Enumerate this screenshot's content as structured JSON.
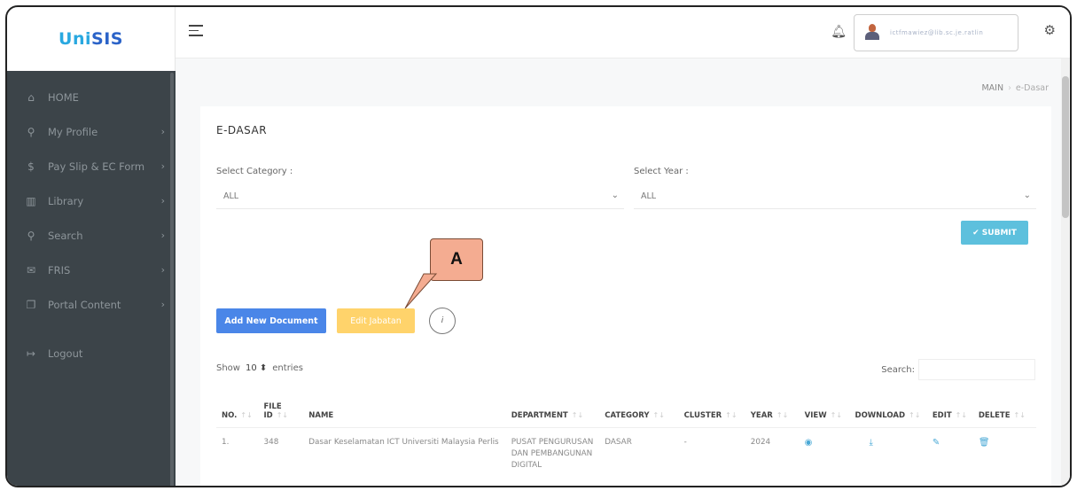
{
  "app": {
    "logo_prefix": "Uni",
    "logo_suffix": "SIS"
  },
  "sidebar": {
    "items": [
      {
        "label": "HOME",
        "icon": "home-icon",
        "glyph": "⌂",
        "has_submenu": false
      },
      {
        "label": "My Profile",
        "icon": "search-icon",
        "glyph": "⚲",
        "has_submenu": true
      },
      {
        "label": "Pay Slip & EC Form",
        "icon": "dollar-icon",
        "glyph": "$",
        "has_submenu": true
      },
      {
        "label": "Library",
        "icon": "book-icon",
        "glyph": "▥",
        "has_submenu": true
      },
      {
        "label": "Search",
        "icon": "search-icon",
        "glyph": "⚲",
        "has_submenu": true
      },
      {
        "label": "FRIS",
        "icon": "mail-icon",
        "glyph": "✉",
        "has_submenu": true
      },
      {
        "label": "Portal Content",
        "icon": "copy-icon",
        "glyph": "❐",
        "has_submenu": true
      }
    ],
    "logout_label": "Logout",
    "submenu_glyph": "›"
  },
  "header": {
    "user_email": "ictfmawiez@lib.sc.je.ratlin"
  },
  "breadcrumb": {
    "root": "MAIN",
    "current": "e-Dasar"
  },
  "page": {
    "title": "E-DASAR",
    "category_label": "Select Category :",
    "category_value": "ALL",
    "year_label": "Select Year :",
    "year_value": "ALL",
    "submit_label": "SUBMIT",
    "callout_label": "A",
    "add_label": "Add New Document",
    "edit_label": "Edit Jabatan",
    "info_label": "i",
    "show_label": "Show",
    "entries_value": "10",
    "entries_label": "entries",
    "search_label": "Search:"
  },
  "table": {
    "headers": [
      "NO.",
      "FILE ID",
      "NAME",
      "DEPARTMENT",
      "CATEGORY",
      "CLUSTER",
      "YEAR",
      "VIEW",
      "DOWNLOAD",
      "EDIT",
      "DELETE"
    ],
    "rows": [
      {
        "no": "1.",
        "file_id": "348",
        "name": "Dasar Keselamatan ICT Universiti Malaysia Perlis",
        "department": "PUSAT PENGURUSAN DAN PEMBANGUNAN DIGITAL",
        "category": "DASAR",
        "cluster": "-",
        "year": "2024"
      }
    ]
  },
  "colors": {
    "sidebar_bg": "#3c4449",
    "submit": "#5dc0dd",
    "add_button": "#4a86e8",
    "edit_button": "#ffd36b",
    "callout": "#f4ac91"
  }
}
